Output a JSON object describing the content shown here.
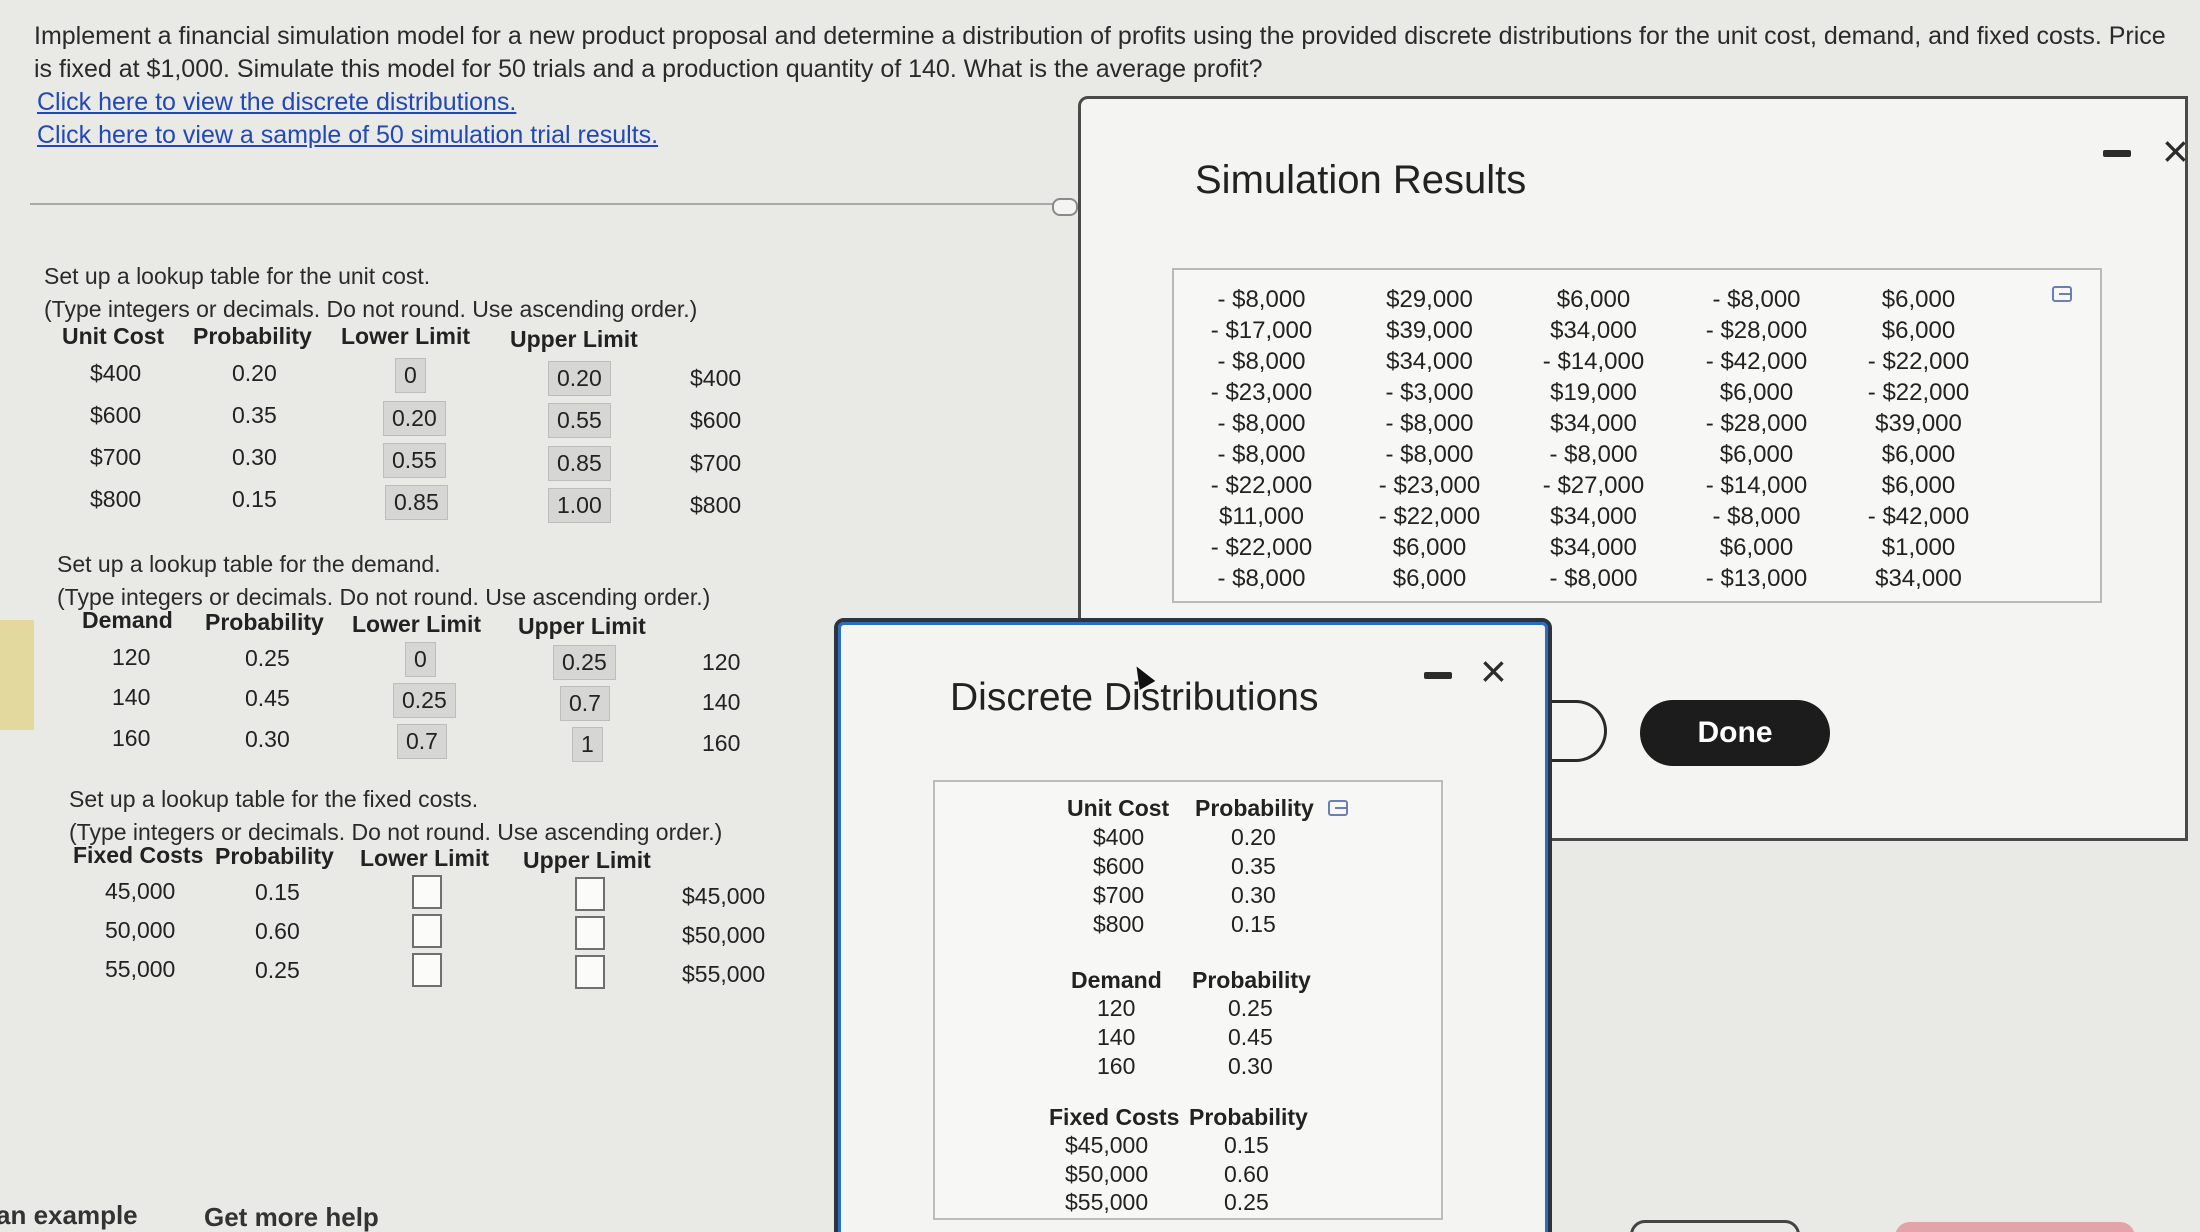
{
  "question": {
    "text": "Implement a financial simulation model for a new product proposal and determine a distribution of profits using the provided discrete distributions for the unit cost, demand, and fixed costs. Price is fixed at $1,000. Simulate this model for 50 trials and a production quantity of 140. What is the average profit?",
    "link_distributions": "Click here to view the discrete distributions.",
    "link_sample": "Click here to view a sample of 50 simulation trial results."
  },
  "unit_cost_section": {
    "intro1": "Set up a lookup table for the unit cost.",
    "intro2": "(Type integers or decimals. Do not round. Use ascending order.)",
    "headers": [
      "Unit Cost",
      "Probability",
      "Lower Limit",
      "Upper Limit"
    ],
    "rows": [
      {
        "value": "$400",
        "prob": "0.20",
        "lower": "0",
        "upper": "0.20",
        "result": "$400"
      },
      {
        "value": "$600",
        "prob": "0.35",
        "lower": "0.20",
        "upper": "0.55",
        "result": "$600"
      },
      {
        "value": "$700",
        "prob": "0.30",
        "lower": "0.55",
        "upper": "0.85",
        "result": "$700"
      },
      {
        "value": "$800",
        "prob": "0.15",
        "lower": "0.85",
        "upper": "1.00",
        "result": "$800"
      }
    ]
  },
  "demand_section": {
    "intro1": "Set up a lookup table for the demand.",
    "intro2": "(Type integers or decimals. Do not round. Use ascending order.)",
    "headers": [
      "Demand",
      "Probability",
      "Lower Limit",
      "Upper Limit"
    ],
    "rows": [
      {
        "value": "120",
        "prob": "0.25",
        "lower": "0",
        "upper": "0.25",
        "result": "120"
      },
      {
        "value": "140",
        "prob": "0.45",
        "lower": "0.25",
        "upper": "0.7",
        "result": "140"
      },
      {
        "value": "160",
        "prob": "0.30",
        "lower": "0.7",
        "upper": "1",
        "result": "160"
      }
    ]
  },
  "fixed_section": {
    "intro1": "Set up a lookup table for the fixed costs.",
    "intro2": "(Type integers or decimals. Do not round. Use ascending order.)",
    "headers": [
      "Fixed Costs",
      "Probability",
      "Lower Limit",
      "Upper Limit"
    ],
    "rows": [
      {
        "value": "45,000",
        "prob": "0.15",
        "result": "$45,000"
      },
      {
        "value": "50,000",
        "prob": "0.60",
        "result": "$50,000"
      },
      {
        "value": "55,000",
        "prob": "0.25",
        "result": "$55,000"
      }
    ]
  },
  "bottom": {
    "example": "an example",
    "help": "Get more help"
  },
  "simulation_results": {
    "title": "Simulation Results",
    "columns": [
      [
        "- $8,000",
        "- $17,000",
        "- $8,000",
        "- $23,000",
        "- $8,000",
        "- $8,000",
        "- $22,000",
        "$11,000",
        "- $22,000",
        "- $8,000"
      ],
      [
        "$29,000",
        "$39,000",
        "$34,000",
        "- $3,000",
        "- $8,000",
        "- $8,000",
        "- $23,000",
        "- $22,000",
        "$6,000",
        "$6,000"
      ],
      [
        "$6,000",
        "$34,000",
        "- $14,000",
        "$19,000",
        "$34,000",
        "- $8,000",
        "- $27,000",
        "$34,000",
        "$34,000",
        "- $8,000"
      ],
      [
        "- $8,000",
        "- $28,000",
        "- $42,000",
        "$6,000",
        "- $28,000",
        "$6,000",
        "- $14,000",
        "- $8,000",
        "$6,000",
        "- $13,000"
      ],
      [
        "$6,000",
        "$6,000",
        "- $22,000",
        "- $22,000",
        "$39,000",
        "$6,000",
        "$6,000",
        "- $42,000",
        "$1,000",
        "$34,000"
      ]
    ],
    "done_label": "Done"
  },
  "discrete_distributions": {
    "title": "Discrete Distributions",
    "unit_cost": {
      "h1": "Unit Cost",
      "h2": "Probability",
      "values": [
        "$400",
        "$600",
        "$700",
        "$800"
      ],
      "probs": [
        "0.20",
        "0.35",
        "0.30",
        "0.15"
      ]
    },
    "demand": {
      "h1": "Demand",
      "h2": "Probability",
      "values": [
        "120",
        "140",
        "160"
      ],
      "probs": [
        "0.25",
        "0.45",
        "0.30"
      ]
    },
    "fixed": {
      "h1": "Fixed Costs",
      "h2": "Probability",
      "values": [
        "$45,000",
        "$50,000",
        "$55,000"
      ],
      "probs": [
        "0.15",
        "0.60",
        "0.25"
      ]
    }
  }
}
